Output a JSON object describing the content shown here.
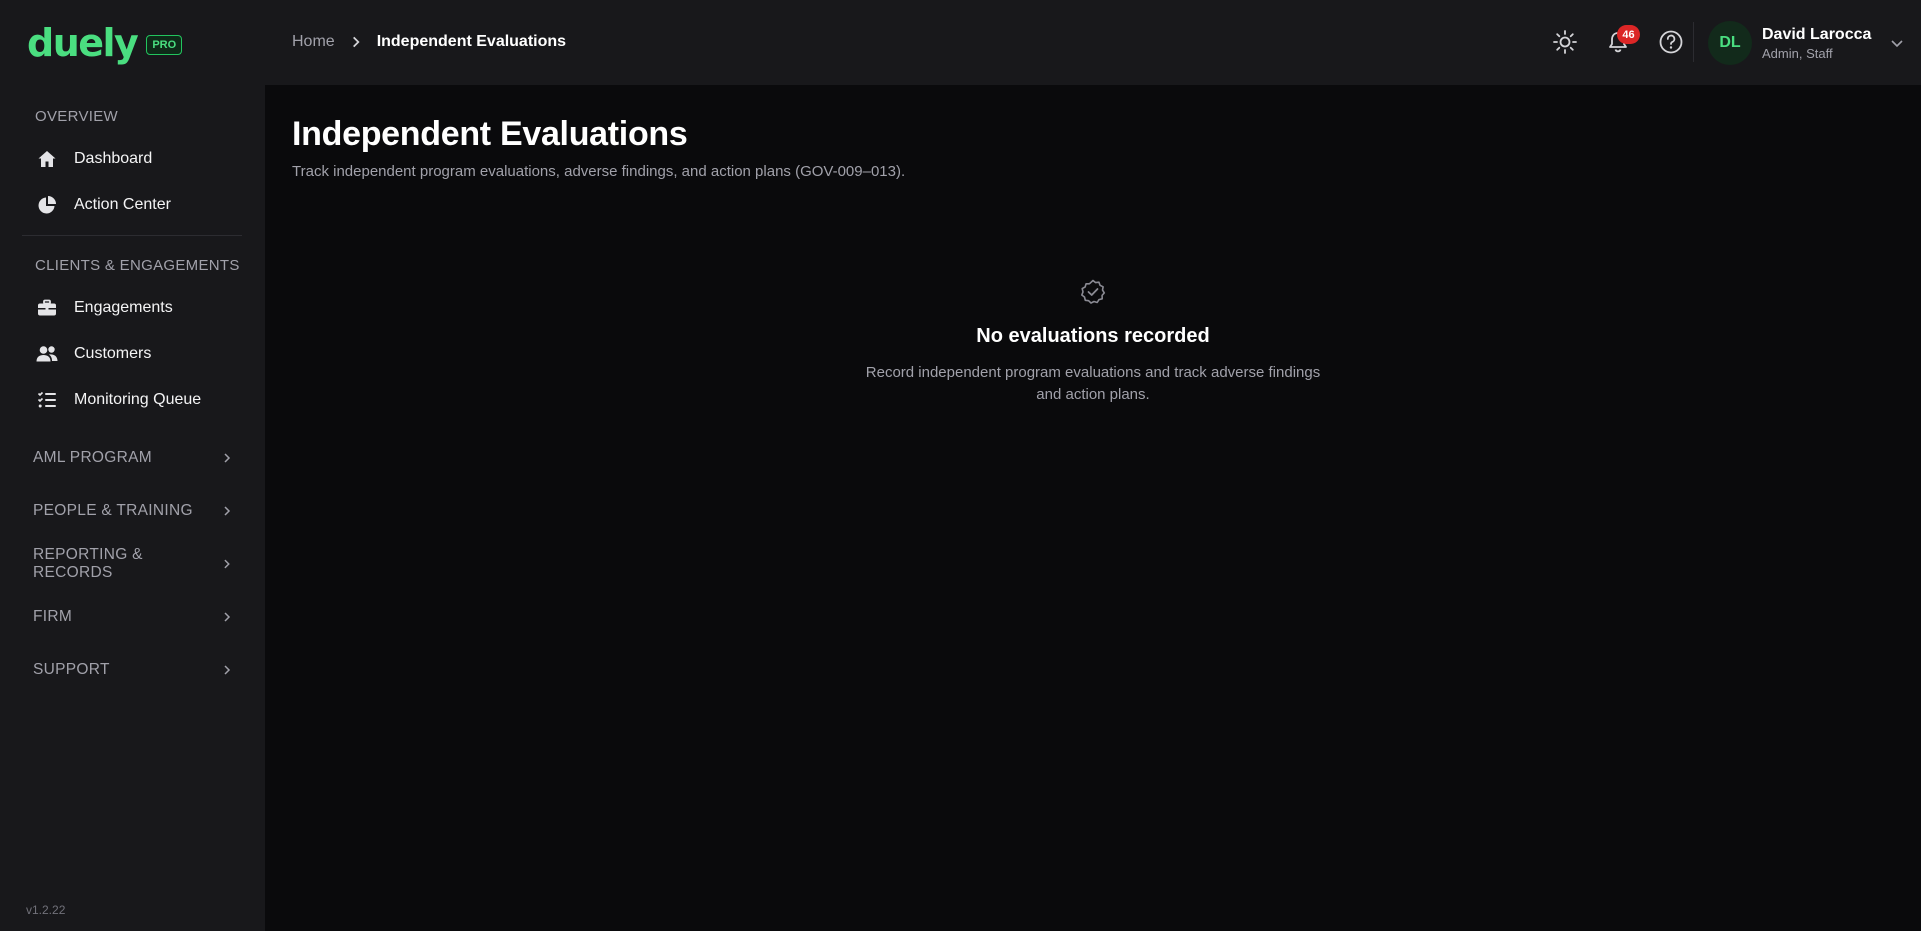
{
  "brand": {
    "logo_text": "duely",
    "badge": "PRO",
    "accent_color": "#4ade80"
  },
  "sidebar": {
    "sections": [
      {
        "label": "OVERVIEW",
        "items": [
          {
            "label": "Dashboard",
            "icon": "home-icon"
          },
          {
            "label": "Action Center",
            "icon": "pie-chart-icon"
          }
        ]
      },
      {
        "label": "CLIENTS & ENGAGEMENTS",
        "items": [
          {
            "label": "Engagements",
            "icon": "briefcase-icon"
          },
          {
            "label": "Customers",
            "icon": "users-icon"
          },
          {
            "label": "Monitoring Queue",
            "icon": "list-check-icon"
          }
        ]
      }
    ],
    "groups": [
      {
        "label": "AML PROGRAM"
      },
      {
        "label": "PEOPLE & TRAINING"
      },
      {
        "label": "REPORTING & RECORDS"
      },
      {
        "label": "FIRM"
      },
      {
        "label": "SUPPORT"
      }
    ],
    "version": "v1.2.22"
  },
  "header": {
    "breadcrumb": {
      "home": "Home",
      "current": "Independent Evaluations"
    },
    "notifications_count": "46",
    "user": {
      "initials": "DL",
      "name": "David Larocca",
      "role": "Admin, Staff"
    }
  },
  "main": {
    "title": "Independent Evaluations",
    "subtitle": "Track independent program evaluations, adverse findings, and action plans (GOV-009–013).",
    "empty_state": {
      "icon": "badge-check-icon",
      "title": "No evaluations recorded",
      "description": "Record independent program evaluations and track adverse findings and action plans."
    }
  }
}
